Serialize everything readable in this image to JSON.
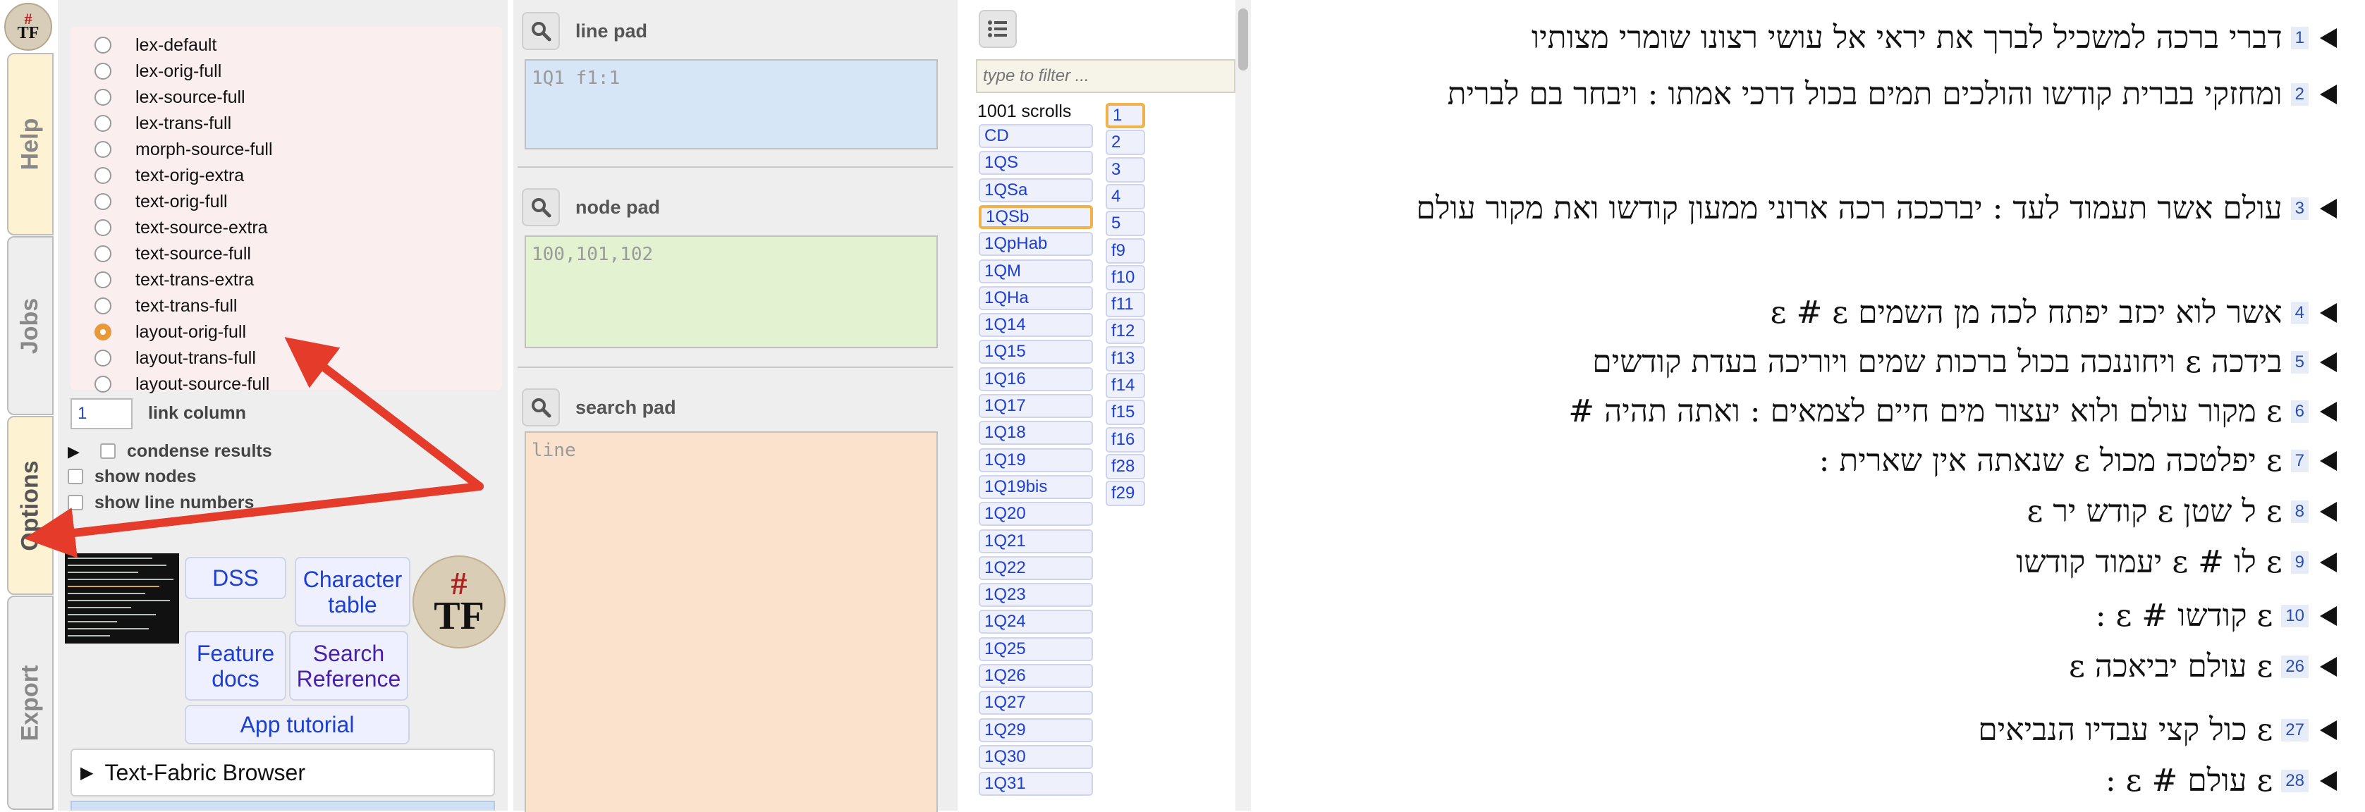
{
  "tabs": {
    "help": "Help",
    "jobs": "Jobs",
    "options": "Options",
    "export": "Export"
  },
  "logo": {
    "hash": "#",
    "tf": "TF"
  },
  "formats": [
    {
      "label": "lex-default",
      "selected": false
    },
    {
      "label": "lex-orig-full",
      "selected": false
    },
    {
      "label": "lex-source-full",
      "selected": false
    },
    {
      "label": "lex-trans-full",
      "selected": false
    },
    {
      "label": "morph-source-full",
      "selected": false
    },
    {
      "label": "text-orig-extra",
      "selected": false
    },
    {
      "label": "text-orig-full",
      "selected": false
    },
    {
      "label": "text-source-extra",
      "selected": false
    },
    {
      "label": "text-source-full",
      "selected": false
    },
    {
      "label": "text-trans-extra",
      "selected": false
    },
    {
      "label": "text-trans-full",
      "selected": false
    },
    {
      "label": "layout-orig-full",
      "selected": true
    },
    {
      "label": "layout-trans-full",
      "selected": false
    },
    {
      "label": "layout-source-full",
      "selected": false
    }
  ],
  "link_column": {
    "value": "1",
    "label": "link column"
  },
  "options": {
    "condense": "condense results",
    "show_nodes": "show nodes",
    "show_line_numbers": "show line numbers"
  },
  "app_buttons": {
    "dss": "DSS",
    "character_table": "Character table",
    "feature_docs": "Feature docs",
    "search_reference": "Search Reference",
    "app_tutorial": "App tutorial"
  },
  "tfb": "Text-Fabric Browser",
  "pads": {
    "line": {
      "title": "line pad",
      "value": "1Q1 f1:1"
    },
    "node": {
      "title": "node pad",
      "value": "100,101,102"
    },
    "search": {
      "title": "search pad",
      "value": "line"
    }
  },
  "scrolls": {
    "filter_placeholder": "type to filter ...",
    "count": "1001 scrolls",
    "items": [
      "CD",
      "1QS",
      "1QSa",
      "1QSb",
      "1QpHab",
      "1QM",
      "1QHa",
      "1Q14",
      "1Q15",
      "1Q16",
      "1Q17",
      "1Q18",
      "1Q19",
      "1Q19bis",
      "1Q20",
      "1Q21",
      "1Q22",
      "1Q23",
      "1Q24",
      "1Q25",
      "1Q26",
      "1Q27",
      "1Q29",
      "1Q30",
      "1Q31"
    ],
    "selected": "1QSb",
    "pages": [
      "1",
      "2",
      "3",
      "4",
      "5",
      "f9",
      "f10",
      "f11",
      "f12",
      "f13",
      "f14",
      "f15",
      "f16",
      "f28",
      "f29"
    ],
    "selected_page": "1"
  },
  "text_lines": [
    {
      "num": "1",
      "text": "דברי ברכה למשכיל לברך את יראי אל עושי רצונו שומרי מצותיו"
    },
    {
      "num": "2",
      "text": "ומחזקי בברית קודשו והולכים תמים בכול דרכי אמתו : ויבחר בם לברית"
    },
    {
      "num": "3",
      "text": "עולם אשר תעמוד לעד : יברככה רכה ארוני ממעון קודשו ואת מקור עולם"
    },
    {
      "num": "4",
      "text": "אשר לוא יכזב יפתח לכה מן השמים ε # ε"
    },
    {
      "num": "5",
      "text": "בידכה ε ויחוננכה בכול ברכות שמים ויוריכה בעדת קודשים"
    },
    {
      "num": "6",
      "text": "ε מקור עולם ולוא יעצור מים חיים לצמאים : ואתה תהיה #"
    },
    {
      "num": "7",
      "text": "ε יפלטכה מכול ε שנאתה אין שארית :"
    },
    {
      "num": "8",
      "text": "ε ל שטן ε קודש יר ε"
    },
    {
      "num": "9",
      "text": "ε לו # ε יעמוד קודשו"
    },
    {
      "num": "10",
      "text": "ε קודשו # ε :"
    },
    {
      "num": "26",
      "text": "ε עולם יביאכה ε"
    },
    {
      "num": "27",
      "text": "ε כול קצי עבדיו הנביאים"
    },
    {
      "num": "28",
      "text": "ε עולם # ε :"
    }
  ],
  "colors": {
    "accent_orange": "#f2b24b",
    "annotation_red": "#e53b2b",
    "link_blue": "#1c3fd1",
    "teal_text": "#4a8c8a"
  }
}
